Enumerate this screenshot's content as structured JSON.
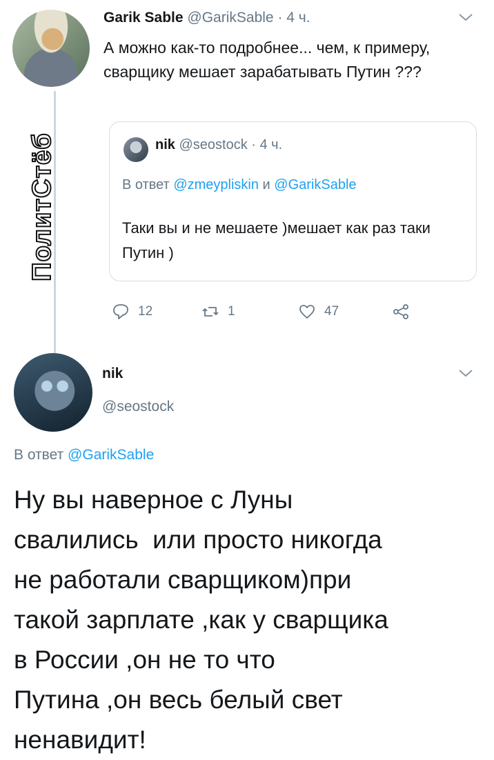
{
  "tweet1": {
    "name": "Garik Sable",
    "handle": "@GarikSable",
    "time": " · 4 ч.",
    "text": "А можно как-то подробнее... чем, к примеру, сварщику мешает зарабатывать Путин ???"
  },
  "quote": {
    "name": "nik",
    "handle": "@seostock",
    "time": " · 4 ч.",
    "reply_prefix": "В ответ ",
    "reply_user1": "@zmeypliskin",
    "reply_and": " и ",
    "reply_user2": "@GarikSable",
    "text": "Таки вы и не мешаете )мешает как раз таки Путин )"
  },
  "actions": {
    "replies": "12",
    "retweets": "1",
    "likes": "47"
  },
  "watermark": "ПолитСтёб",
  "tweet2": {
    "name": "nik",
    "handle": "@seostock",
    "reply_prefix": "В ответ ",
    "reply_user": "@GarikSable",
    "text": "Ну вы наверное с Луны\nсвалились  или просто никогда\nне работали сварщиком)при\nтакой зарплате ,как у сварщика\nв России ,он не то что\nПутина ,он весь белый свет\nненавидит!"
  },
  "colors": {
    "link": "#1da1f2",
    "meta": "#657786",
    "border": "#d6dde3"
  }
}
